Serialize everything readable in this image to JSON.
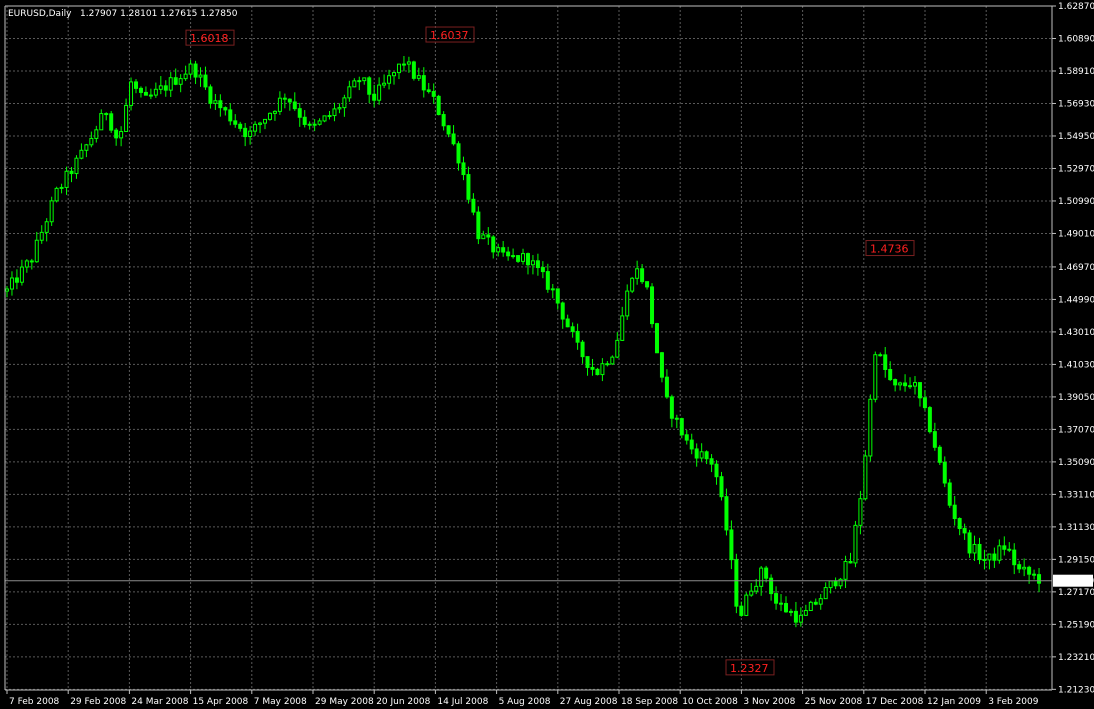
{
  "header": {
    "symbol": "EURUSD,Daily",
    "ohlc": "1.27907 1.28101 1.27615 1.27850"
  },
  "colors": {
    "background": "#000000",
    "candle": "#00ff00",
    "grid": "#5a5a5a",
    "axis": "#c0c0c0",
    "annotation": "#ff2020",
    "price_line": "#8c8c8c",
    "price_tag_bg": "#ffffff"
  },
  "chart_data": {
    "type": "candlestick",
    "symbol": "EURUSD",
    "timeframe": "Daily",
    "ylim": [
      1.2119,
      1.6287
    ],
    "y_ticks": [
      "1.62870",
      "1.60890",
      "1.58910",
      "1.56930",
      "1.54950",
      "1.52970",
      "1.50990",
      "1.49010",
      "1.46970",
      "1.44990",
      "1.43010",
      "1.41030",
      "1.39050",
      "1.37070",
      "1.35090",
      "1.33110",
      "1.31130",
      "1.29150",
      "1.27170",
      "1.25190",
      "1.23210",
      "1.21230"
    ],
    "x_ticks": [
      "7 Feb 2008",
      "29 Feb 2008",
      "24 Mar 2008",
      "15 Apr 2008",
      "7 May 2008",
      "29 May 2008",
      "20 Jun 2008",
      "14 Jul 2008",
      "5 Aug 2008",
      "27 Aug 2008",
      "18 Sep 2008",
      "10 Oct 2008",
      "3 Nov 2008",
      "25 Nov 2008",
      "17 Dec 2008",
      "12 Jan 2009",
      "3 Feb 2009"
    ],
    "grid": true,
    "current_price": "1.27850",
    "current_price_value": 1.2785,
    "annotations": [
      {
        "label": "1.6018",
        "value": 1.6018,
        "at": "15 Apr 2008"
      },
      {
        "label": "1.6037",
        "value": 1.6037,
        "at": "14 Jul 2008"
      },
      {
        "label": "1.2327",
        "value": 1.2327,
        "at": "27 Oct 2008"
      },
      {
        "label": "1.4736",
        "value": 1.4736,
        "at": "17 Dec 2008"
      }
    ],
    "path_keypoints": [
      [
        0,
        1.455
      ],
      [
        20,
        1.475
      ],
      [
        40,
        1.515
      ],
      [
        60,
        1.538
      ],
      [
        80,
        1.565
      ],
      [
        90,
        1.545
      ],
      [
        100,
        1.582
      ],
      [
        110,
        1.57
      ],
      [
        150,
        1.592
      ],
      [
        165,
        1.572
      ],
      [
        195,
        1.55
      ],
      [
        225,
        1.575
      ],
      [
        245,
        1.553
      ],
      [
        265,
        1.565
      ],
      [
        285,
        1.585
      ],
      [
        295,
        1.572
      ],
      [
        320,
        1.595
      ],
      [
        345,
        1.57
      ],
      [
        365,
        1.535
      ],
      [
        380,
        1.49
      ],
      [
        400,
        1.475
      ],
      [
        420,
        1.475
      ],
      [
        440,
        1.455
      ],
      [
        460,
        1.42
      ],
      [
        475,
        1.405
      ],
      [
        490,
        1.42
      ],
      [
        505,
        1.47
      ],
      [
        515,
        1.46
      ],
      [
        530,
        1.39
      ],
      [
        550,
        1.36
      ],
      [
        570,
        1.35
      ],
      [
        580,
        1.31
      ],
      [
        590,
        1.255
      ],
      [
        600,
        1.275
      ],
      [
        610,
        1.285
      ],
      [
        620,
        1.265
      ],
      [
        640,
        1.255
      ],
      [
        660,
        1.272
      ],
      [
        680,
        1.29
      ],
      [
        690,
        1.34
      ],
      [
        700,
        1.42
      ],
      [
        715,
        1.395
      ],
      [
        730,
        1.4
      ],
      [
        745,
        1.37
      ],
      [
        760,
        1.325
      ],
      [
        775,
        1.3
      ],
      [
        790,
        1.29
      ],
      [
        805,
        1.3
      ],
      [
        815,
        1.285
      ],
      [
        835,
        1.279
      ]
    ]
  }
}
